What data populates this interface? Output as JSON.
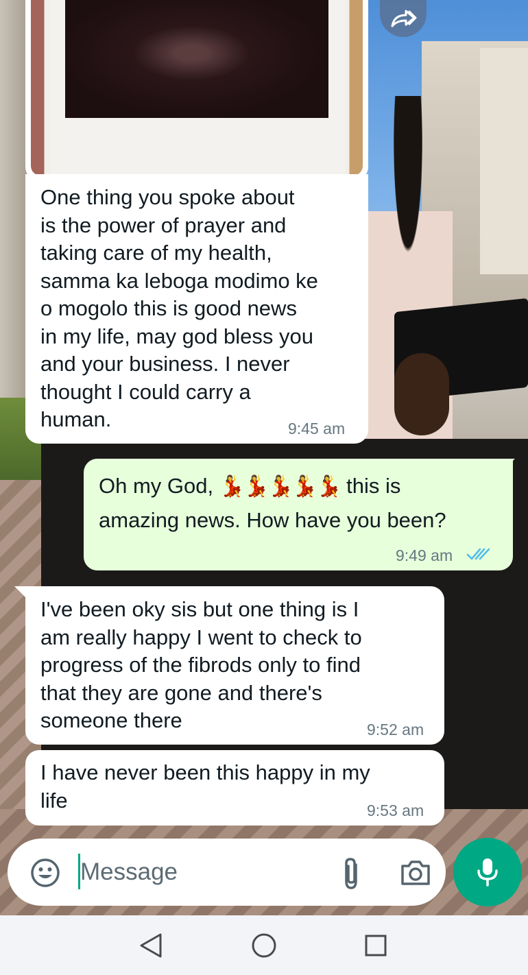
{
  "chat": {
    "forward_icon": "forward-icon",
    "messages": [
      {
        "direction": "incoming",
        "has_image": true,
        "text": "One thing you spoke about\nis the power of prayer and\ntaking care of my health,\nsamma ka leboga modimo ke\no mogolo this is good news\nin my life, may god bless you\nand your business. I never\nthought I could carry a\nhuman.",
        "time": "9:45 am"
      },
      {
        "direction": "outgoing",
        "text_before": "Oh my God,",
        "emoji": "💃💃💃💃💃",
        "text_after": "this is",
        "text_line2": "amazing news. How have you been?",
        "time": "9:49 am",
        "status": "read",
        "status_color": "#53bdeb"
      },
      {
        "direction": "incoming",
        "text": "I've been oky sis but one thing is I\nam really happy I went to check to\nprogress of the fibrods only to find\nthat they are gone and there's\nsomeone there",
        "time": "9:52 am"
      },
      {
        "direction": "incoming",
        "text": "I have never been this happy in my\nlife",
        "time": "9:53 am"
      }
    ]
  },
  "composer": {
    "placeholder": "Message",
    "emoji_icon": "emoji-icon",
    "attach_icon": "paperclip-icon",
    "camera_icon": "camera-icon",
    "mic_icon": "microphone-icon"
  },
  "nav": {
    "back_icon": "back-triangle-icon",
    "home_icon": "home-circle-icon",
    "recents_icon": "recents-square-icon"
  },
  "colors": {
    "accent": "#00a884",
    "outgoing_bubble": "#e7ffdb",
    "incoming_bubble": "#ffffff",
    "timestamp": "#667781",
    "read_ticks": "#53bdeb"
  }
}
